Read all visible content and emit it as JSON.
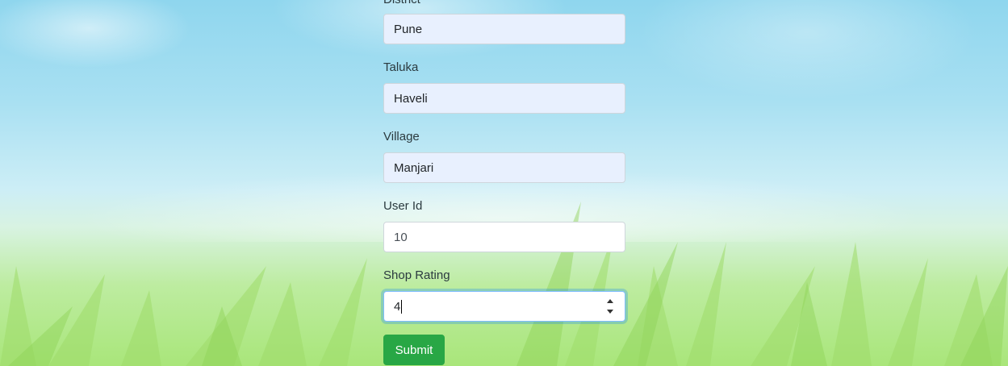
{
  "form": {
    "district": {
      "label": "District",
      "value": "Pune"
    },
    "taluka": {
      "label": "Taluka",
      "value": "Haveli"
    },
    "village": {
      "label": "Village",
      "value": "Manjari"
    },
    "user_id": {
      "label": "User Id",
      "value": "10"
    },
    "shop_rating": {
      "label": "Shop Rating",
      "value": "4"
    },
    "submit_label": "Submit"
  },
  "colors": {
    "submit_button": "#28a745",
    "autofill_field": "#e8f0fe",
    "focus_ring": "#80bdff"
  },
  "icons": {
    "spinner": "number-spinner-icon"
  }
}
